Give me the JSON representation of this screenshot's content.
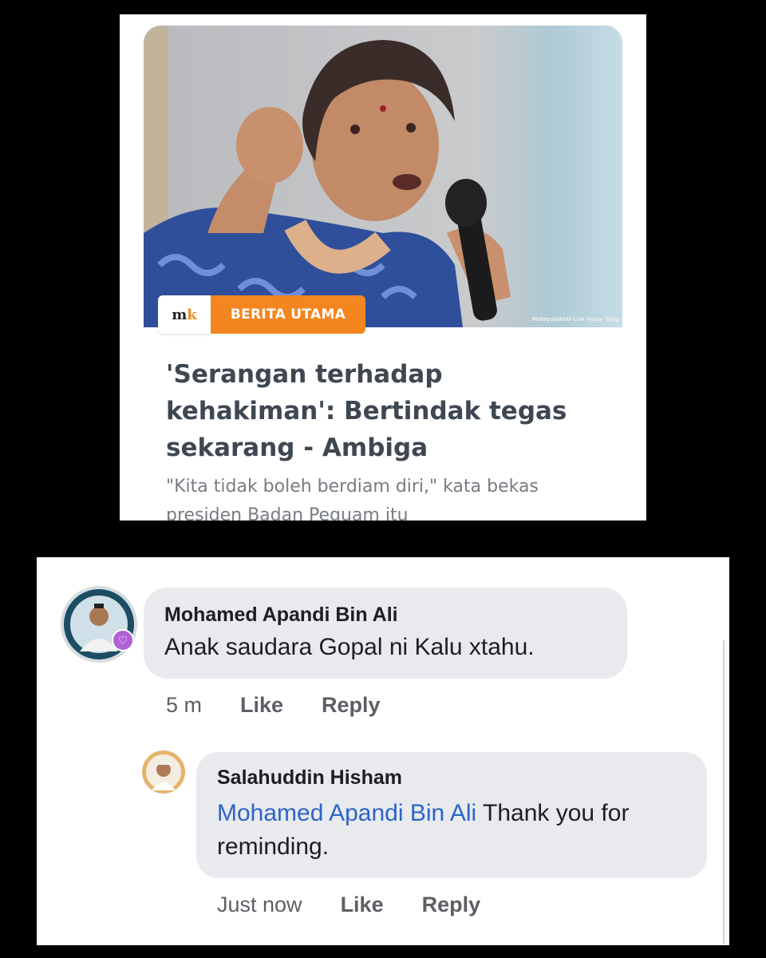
{
  "article": {
    "photo_credit": "Malaysiakini-Lim Huey Teng",
    "logo": {
      "main": "m",
      "accent": "k"
    },
    "section_tag": "BERITA UTAMA",
    "headline": "'Serangan terhadap kehakiman': Bertindak tegas sekarang - Ambiga",
    "summary": "\"Kita tidak boleh berdiam diri,\" kata bekas presiden Badan Peguam itu",
    "colors": {
      "tag": "#f4861f",
      "headline": "#3f4752",
      "summary": "#777c82"
    }
  },
  "comments": [
    {
      "author": "Mohamed Apandi Bin Ali",
      "text": "Anak saudara Gopal ni Kalu xtahu.",
      "time": "5 m",
      "like_label": "Like",
      "reply_label": "Reply"
    }
  ],
  "replies": [
    {
      "author": "Salahuddin Hisham",
      "mention": "Mohamed Apandi Bin Ali",
      "text": "Thank you for reminding.",
      "time": "Just now",
      "like_label": "Like",
      "reply_label": "Reply"
    }
  ],
  "icons": {
    "avatar_badge": "heart-badge-icon"
  },
  "colors": {
    "bubble": "#e9eaee",
    "mention": "#2c64c8",
    "meta": "#5c5f64"
  }
}
